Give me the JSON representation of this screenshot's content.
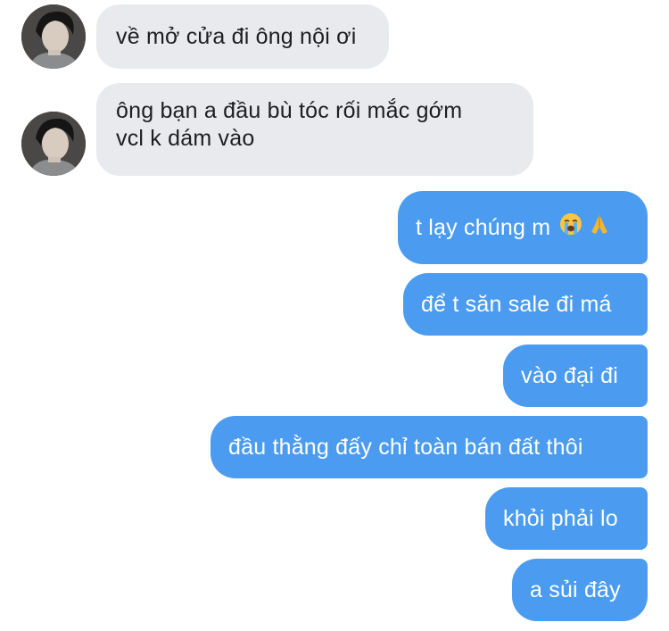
{
  "thread": {
    "contact_avatar_1": "avatar-photo",
    "contact_avatar_2": "avatar-photo",
    "incoming": [
      {
        "text": "về mở cửa đi ông nội ơi"
      },
      {
        "line1": "ông bạn a đầu bù tóc rối mắc gớm",
        "line2": "vcl k dám vào"
      }
    ],
    "outgoing": [
      {
        "text": "t lạy chúng m",
        "emojis": [
          "loudly-crying-face-emoji",
          "folded-hands-emoji"
        ]
      },
      {
        "text": "để t săn sale đi má"
      },
      {
        "text": "vào đại đi"
      },
      {
        "text": "đầu thằng đấy chỉ toàn bán đất thôi"
      },
      {
        "text": "khỏi phải lo"
      },
      {
        "text": "a sủi đây"
      }
    ]
  },
  "colors": {
    "incoming_bubble": "#e9eaee",
    "outgoing_bubble": "#4b9cf0",
    "incoming_text": "#1c1e21",
    "outgoing_text": "#ffffff"
  }
}
